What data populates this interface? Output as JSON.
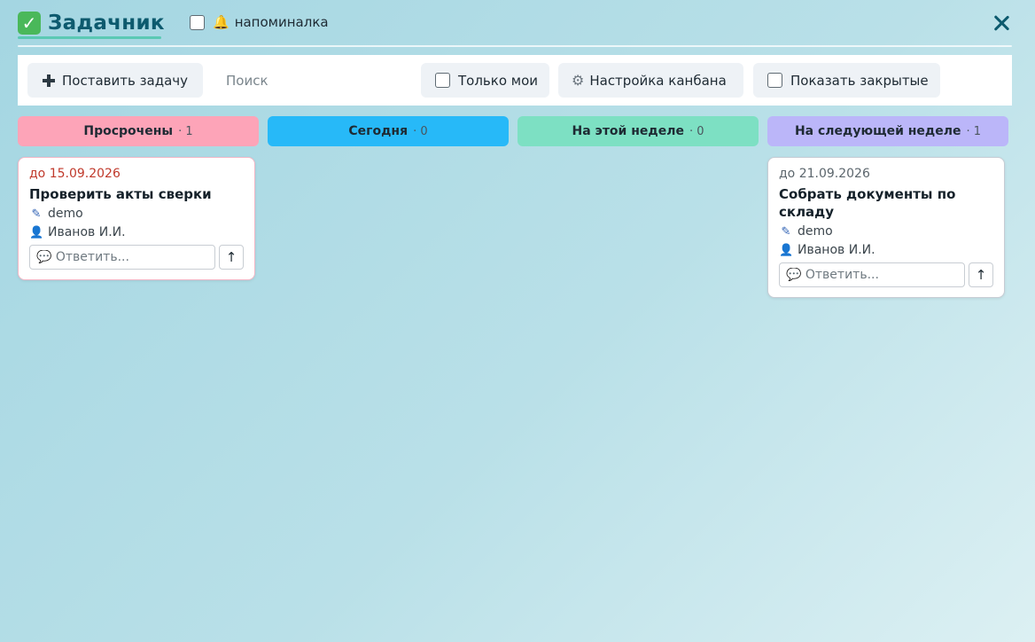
{
  "app": {
    "title": "Задачник",
    "title_icon": "check-box-icon",
    "reminder_label": "напоминалка",
    "reminder_icon": "bell-icon",
    "reminder_checked": false,
    "close_icon": "close-icon"
  },
  "toolbar": {
    "add_task_label": "Поставить задачу",
    "search_placeholder": "Поиск",
    "search_value": "",
    "only_mine_label": "Только мои",
    "only_mine_checked": false,
    "kanban_settings_label": "Настройка канбана",
    "show_closed_label": "Показать закрытые",
    "show_closed_checked": false
  },
  "columns": [
    {
      "title": "Просрочены",
      "count": "· 1",
      "color": "#fda4b8",
      "cards": [
        {
          "due": "до 15.09.2026",
          "title": "Проверить акты сверки",
          "author": "demo",
          "assignee": "Иванов И.И.",
          "reply_placeholder": "💬 Ответить...",
          "send_label": "↑"
        }
      ]
    },
    {
      "title": "Сегодня",
      "count": "· 0",
      "color": "#27b9f8",
      "cards": []
    },
    {
      "title": "На этой неделе",
      "count": "· 0",
      "color": "#7de0c3",
      "cards": []
    },
    {
      "title": "На следующей неделе",
      "count": "· 1",
      "color": "#bbb6f9",
      "cards": [
        {
          "due": "до 21.09.2026",
          "title": "Собрать документы по складу",
          "author": "demo",
          "assignee": "Иванов И.И.",
          "reply_placeholder": "💬 Ответить...",
          "send_label": "↑"
        }
      ]
    }
  ]
}
